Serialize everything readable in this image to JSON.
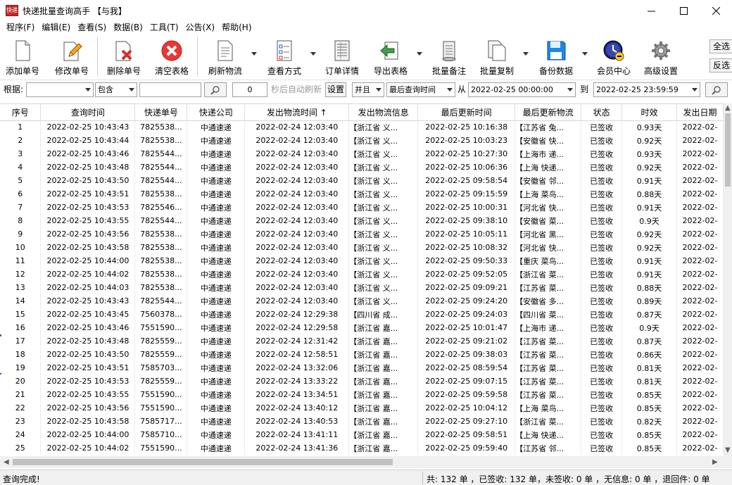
{
  "window": {
    "title": "快递批量查询高手 【与我】",
    "icon_text": "快递"
  },
  "menu": [
    "程序(F)",
    "编辑(E)",
    "查看(S)",
    "数据(B)",
    "工具(T)",
    "公告(X)",
    "帮助(H)"
  ],
  "toolbar": {
    "add": "添加单号",
    "edit": "修改单号",
    "delete": "删除单号",
    "clear": "清空表格",
    "refresh": "刷新物流",
    "view_mode": "查看方式",
    "order_detail": "订单详情",
    "export": "导出表格",
    "batch_note": "批量备注",
    "batch_copy": "批量复制",
    "backup": "备份数据",
    "member": "会员中心",
    "advanced": "高级设置",
    "select_all": "全选",
    "invert": "反选"
  },
  "filter": {
    "according_label": "根据:",
    "field_value": "",
    "op_value": "包含",
    "keyword": "",
    "interval_value": "0",
    "auto_refresh_label": "秒后自动刷新",
    "settings": "设置",
    "logic_value": "并且",
    "time_field_value": "最后查询时间",
    "from_label": "从",
    "from_value": "2022-02-25 00:00:00",
    "to_label": "到",
    "to_value": "2022-02-25 23:59:59"
  },
  "table": {
    "headers": [
      "序号",
      "查询时间",
      "快递单号",
      "快递公司",
      "发出物流时间 ↑",
      "发出物流信息",
      "最后更新时间",
      "最后更新物流",
      "状态",
      "时效",
      "发出日期"
    ],
    "rows": [
      [
        "1",
        "2022-02-25 10:43:43",
        "7825538...",
        "中通速递",
        "2022-02-24 12:03:40",
        "【浙江省 义...",
        "2022-02-25 10:16:38",
        "【江苏省 兔...",
        "已签收",
        "0.93天",
        "2022-02-"
      ],
      [
        "2",
        "2022-02-25 10:43:44",
        "7825538...",
        "中通速递",
        "2022-02-24 12:03:40",
        "【浙江省 义...",
        "2022-02-25 10:03:23",
        "【安徽省 快...",
        "已签收",
        "0.92天",
        "2022-02-"
      ],
      [
        "3",
        "2022-02-25 10:43:46",
        "7825544...",
        "中通速递",
        "2022-02-24 12:03:40",
        "【浙江省 义...",
        "2022-02-25 10:27:30",
        "【上海市 递...",
        "已签收",
        "0.93天",
        "2022-02-"
      ],
      [
        "4",
        "2022-02-25 10:43:48",
        "7825544...",
        "中通速递",
        "2022-02-24 12:03:40",
        "【浙江省 义...",
        "2022-02-25 10:06:36",
        "【上海 快递...",
        "已签收",
        "0.92天",
        "2022-02-"
      ],
      [
        "5",
        "2022-02-25 10:43:50",
        "7825544...",
        "中通速递",
        "2022-02-24 12:03:40",
        "【浙江省 义...",
        "2022-02-25 09:58:54",
        "【安徽省 邻...",
        "已签收",
        "0.91天",
        "2022-02-"
      ],
      [
        "6",
        "2022-02-25 10:43:51",
        "7825538...",
        "中通速递",
        "2022-02-24 12:03:40",
        "【浙江省 义...",
        "2022-02-25 09:15:59",
        "【上海 菜鸟...",
        "已签收",
        "0.88天",
        "2022-02-"
      ],
      [
        "7",
        "2022-02-25 10:43:53",
        "7825546...",
        "中通速递",
        "2022-02-24 12:03:40",
        "【浙江省 义...",
        "2022-02-25 10:00:31",
        "【河北省 快...",
        "已签收",
        "0.91天",
        "2022-02-"
      ],
      [
        "8",
        "2022-02-25 10:43:55",
        "7825544...",
        "中通速递",
        "2022-02-24 12:03:40",
        "【浙江省 义...",
        "2022-02-25 09:38:10",
        "【安徽省 菜...",
        "已签收",
        "0.9天",
        "2022-02-"
      ],
      [
        "9",
        "2022-02-25 10:43:56",
        "7825538...",
        "中通速递",
        "2022-02-24 12:03:40",
        "【浙江省 义...",
        "2022-02-25 10:05:11",
        "【河北省 黑...",
        "已签收",
        "0.92天",
        "2022-02-"
      ],
      [
        "10",
        "2022-02-25 10:43:58",
        "7825538...",
        "中通速递",
        "2022-02-24 12:03:40",
        "【浙江省 义...",
        "2022-02-25 10:08:32",
        "【河北省 快...",
        "已签收",
        "0.92天",
        "2022-02-"
      ],
      [
        "11",
        "2022-02-25 10:44:00",
        "7825538...",
        "中通速递",
        "2022-02-24 12:03:40",
        "【浙江省 义...",
        "2022-02-25 09:50:33",
        "【重庆 菜鸟...",
        "已签收",
        "0.91天",
        "2022-02-"
      ],
      [
        "12",
        "2022-02-25 10:44:02",
        "7825538...",
        "中通速递",
        "2022-02-24 12:03:40",
        "【浙江省 义...",
        "2022-02-25 09:52:05",
        "【浙江省 菜...",
        "已签收",
        "0.91天",
        "2022-02-"
      ],
      [
        "13",
        "2022-02-25 10:44:03",
        "7825538...",
        "中通速递",
        "2022-02-24 12:03:40",
        "【浙江省 义...",
        "2022-02-25 09:09:21",
        "【江苏省 菜...",
        "已签收",
        "0.88天",
        "2022-02-"
      ],
      [
        "14",
        "2022-02-25 10:43:43",
        "7825544...",
        "中通速递",
        "2022-02-24 12:03:40",
        "【浙江省 义...",
        "2022-02-25 09:24:20",
        "【安徽省 多...",
        "已签收",
        "0.89天",
        "2022-02-"
      ],
      [
        "15",
        "2022-02-25 10:43:45",
        "7560378...",
        "中通速递",
        "2022-02-24 12:29:38",
        "【四川省 成...",
        "2022-02-25 09:24:03",
        "【四川省 菜...",
        "已签收",
        "0.87天",
        "2022-02-"
      ],
      [
        "16",
        "2022-02-25 10:43:46",
        "7551590...",
        "中通速递",
        "2022-02-24 12:29:58",
        "【浙江省 嘉...",
        "2022-02-25 10:01:47",
        "【上海市 递...",
        "已签收",
        "0.9天",
        "2022-02-"
      ],
      [
        "17",
        "2022-02-25 10:43:48",
        "7825559...",
        "中通速递",
        "2022-02-24 12:31:42",
        "【浙江省 嘉...",
        "2022-02-25 09:21:02",
        "【江苏省 菜...",
        "已签收",
        "0.87天",
        "2022-02-"
      ],
      [
        "18",
        "2022-02-25 10:43:50",
        "7825559...",
        "中通速递",
        "2022-02-24 12:58:51",
        "【浙江省 嘉...",
        "2022-02-25 09:38:03",
        "【江苏省 菜...",
        "已签收",
        "0.86天",
        "2022-02-"
      ],
      [
        "19",
        "2022-02-25 10:43:51",
        "7585703...",
        "中通速递",
        "2022-02-24 13:32:06",
        "【浙江省 嘉...",
        "2022-02-25 08:59:54",
        "【江苏省 菜...",
        "已签收",
        "0.81天",
        "2022-02-"
      ],
      [
        "20",
        "2022-02-25 10:43:53",
        "7825559...",
        "中通速递",
        "2022-02-24 13:33:22",
        "【浙江省 嘉...",
        "2022-02-25 09:07:15",
        "【江苏省 菜...",
        "已签收",
        "0.81天",
        "2022-02-"
      ],
      [
        "21",
        "2022-02-25 10:43:55",
        "7551590...",
        "中通速递",
        "2022-02-24 13:34:51",
        "【浙江省 嘉...",
        "2022-02-25 09:59:58",
        "【江苏省 菜...",
        "已签收",
        "0.85天",
        "2022-02-"
      ],
      [
        "22",
        "2022-02-25 10:43:56",
        "7551590...",
        "中通速递",
        "2022-02-24 13:40:12",
        "【浙江省 嘉...",
        "2022-02-25 10:04:12",
        "【上海 菜鸟...",
        "已签收",
        "0.85天",
        "2022-02-"
      ],
      [
        "23",
        "2022-02-25 10:43:58",
        "7585717...",
        "中通速递",
        "2022-02-24 13:40:53",
        "【浙江省 嘉...",
        "2022-02-25 09:27:10",
        "【浙江省 菜...",
        "已签收",
        "0.82天",
        "2022-02-"
      ],
      [
        "24",
        "2022-02-25 10:44:00",
        "7585710...",
        "中通速递",
        "2022-02-24 13:41:11",
        "【浙江省 嘉...",
        "2022-02-25 09:58:51",
        "【上海 快递...",
        "已签收",
        "0.85天",
        "2022-02-"
      ],
      [
        "25",
        "2022-02-25 10:44:02",
        "7551590...",
        "中通速递",
        "2022-02-24 13:41:36",
        "【浙江省 嘉...",
        "2022-02-25 09:59:40",
        "【江苏省 邻...",
        "已签收",
        "0.85天",
        "2022-02-"
      ]
    ]
  },
  "status": {
    "left": "查询完成!",
    "right": "共: 132 单 ，已签收: 132 单，未签收: 0 单 ，无信息: 0 单 ，退回件: 0 单"
  },
  "colors": {
    "delete_red": "#d32f2f",
    "export_green": "#2e7d32",
    "backup_blue": "#1565c0",
    "member_navy": "#1a237e"
  }
}
